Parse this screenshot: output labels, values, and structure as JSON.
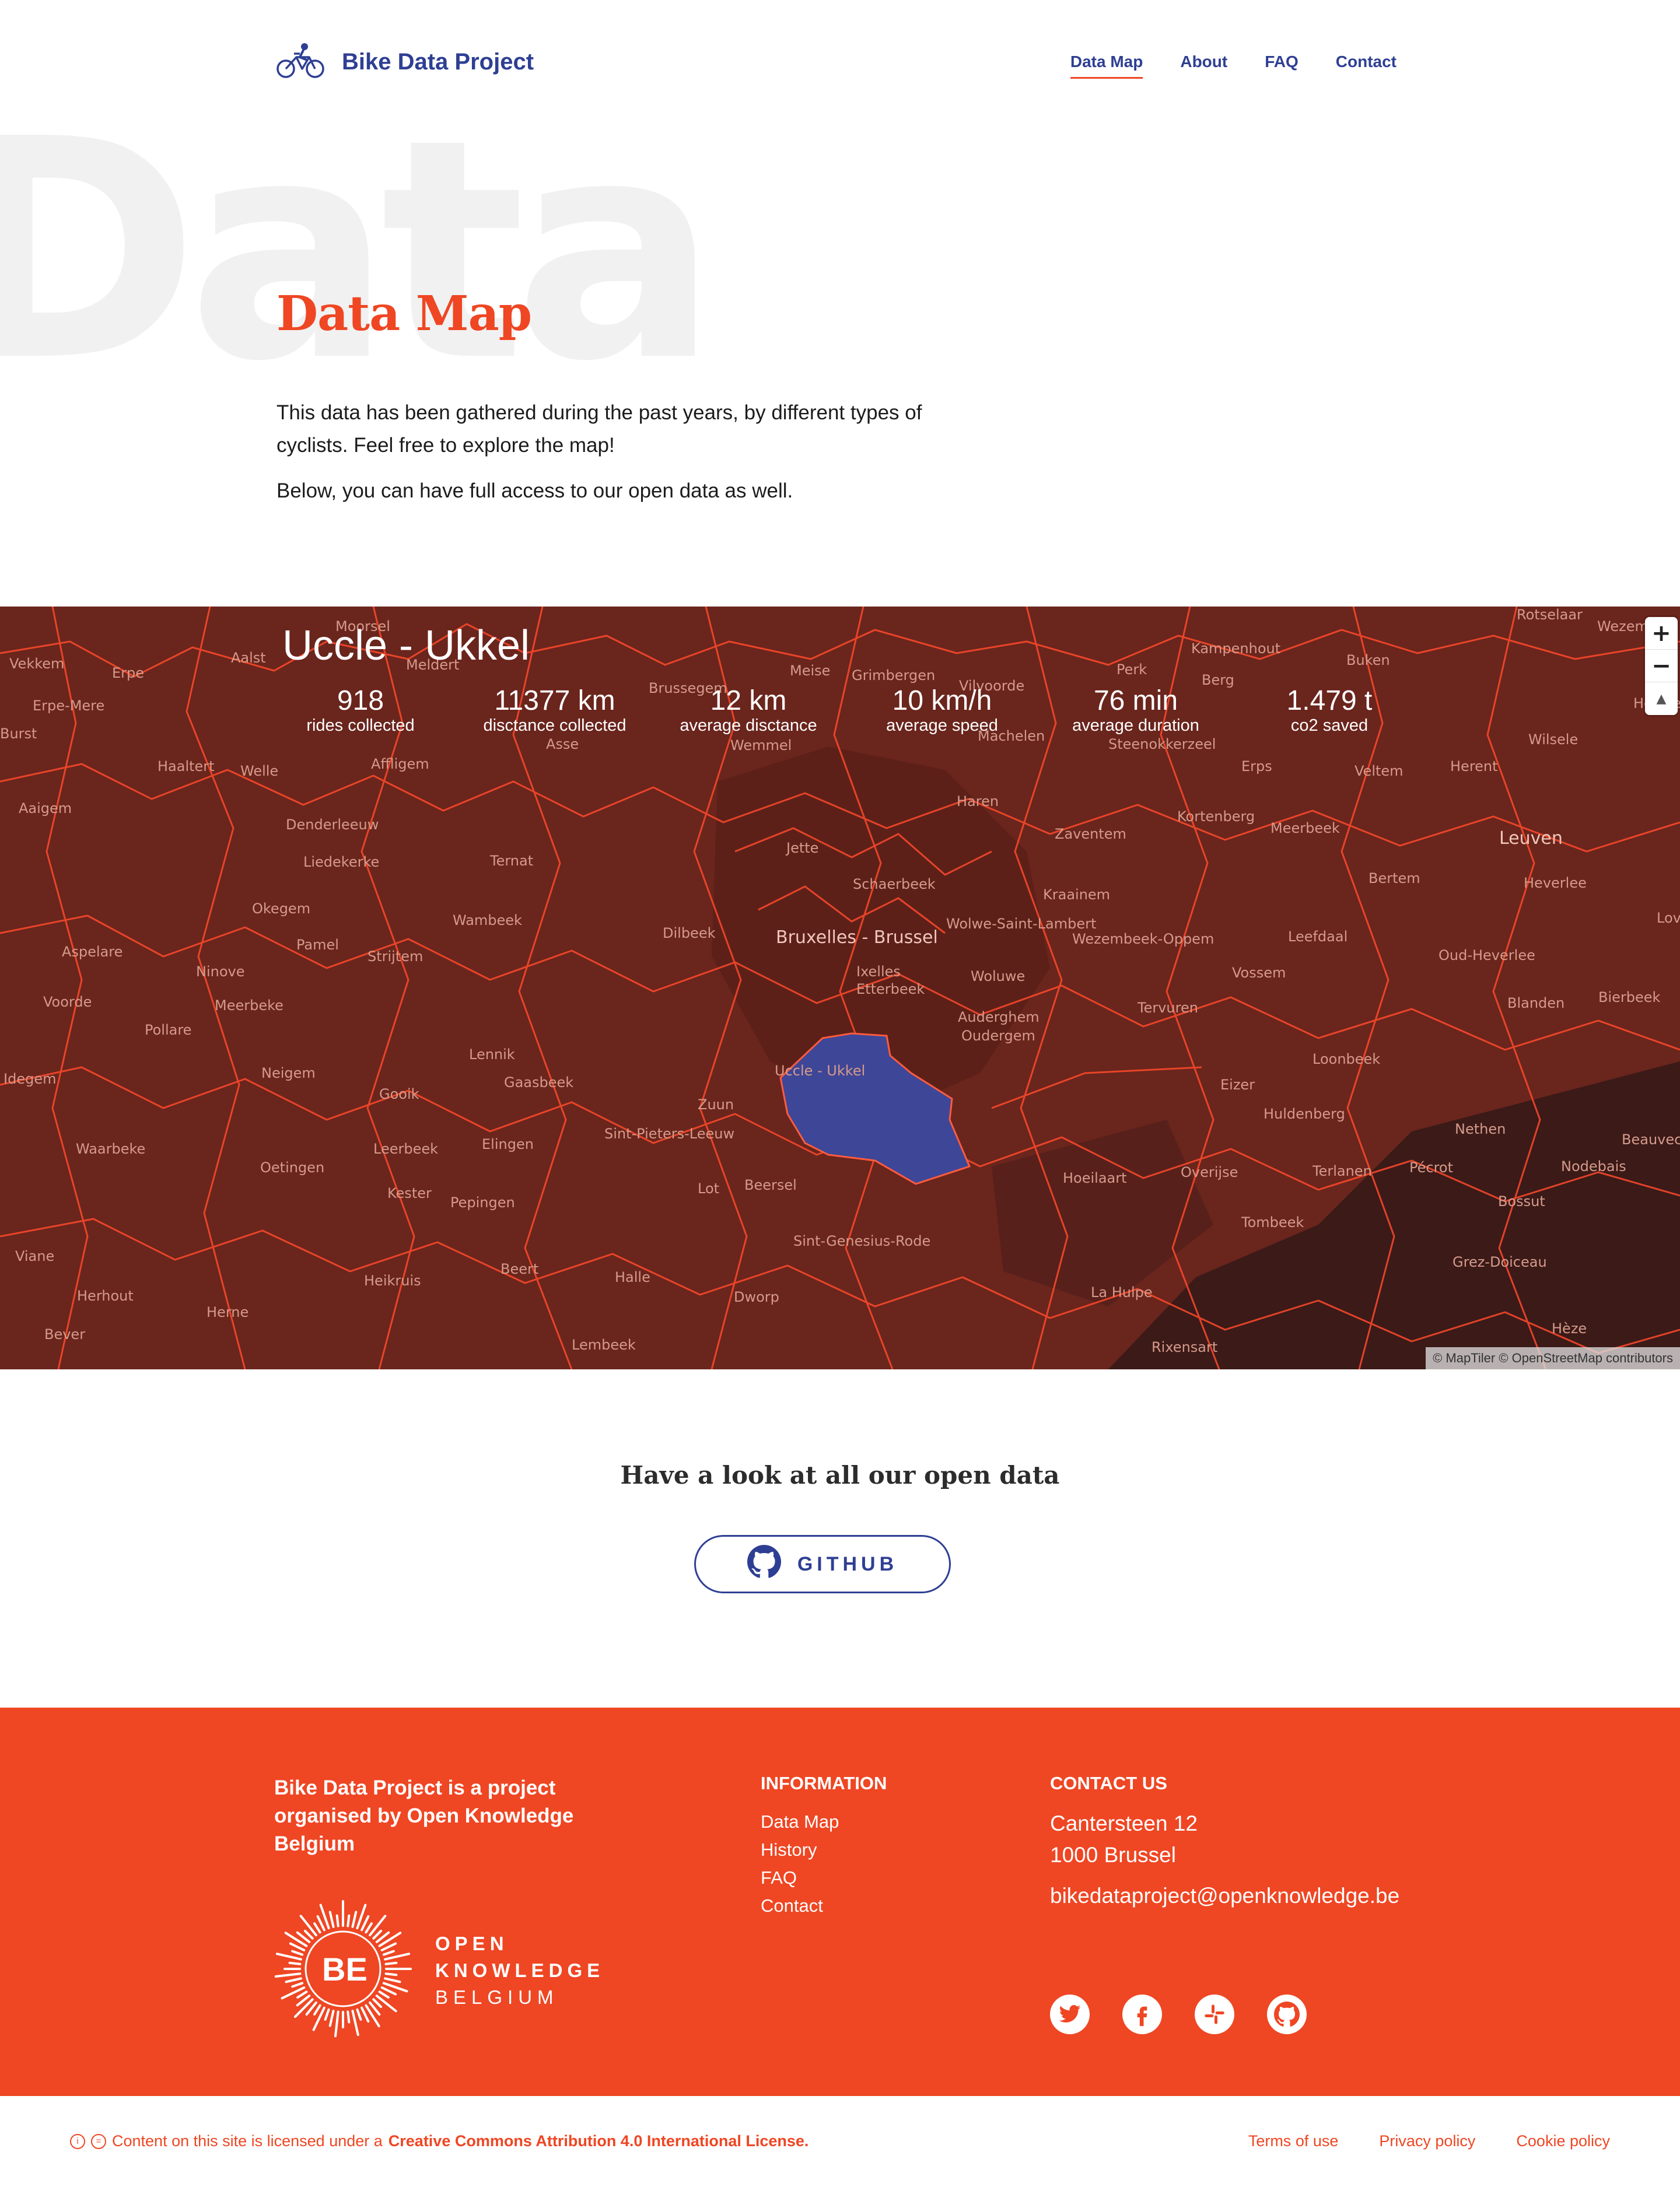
{
  "header": {
    "brand": "Bike Data Project",
    "nav": [
      {
        "label": "Data Map",
        "active": true
      },
      {
        "label": "About"
      },
      {
        "label": "FAQ"
      },
      {
        "label": "Contact"
      }
    ]
  },
  "hero": {
    "ghost_word": "Data",
    "title": "Data Map",
    "paragraphs": [
      "This data has been gathered during the past years, by different types of cyclists. Feel free to explore the map!",
      "Below, you can have full access to our open data as well."
    ]
  },
  "map": {
    "region_name": "Uccle - Ukkel",
    "stats": [
      {
        "value": "918",
        "label": "rides collected"
      },
      {
        "value": "11377 km",
        "label": "disctance collected"
      },
      {
        "value": "12 km",
        "label": "average disctance"
      },
      {
        "value": "10 km/h",
        "label": "average speed"
      },
      {
        "value": "76 min",
        "label": "average duration"
      },
      {
        "value": "1.479 t",
        "label": "co2 saved"
      }
    ],
    "controls": {
      "zoom_in": "+",
      "zoom_out": "−",
      "reset": "▲"
    },
    "attribution": "© MapTiler © OpenStreetMap contributors",
    "places": [
      "Moorsel",
      "Aalst",
      "Erpe",
      "Erpe-Mere",
      "Burst",
      "Haaltert",
      "Welle",
      "Aaigem",
      "Meldert",
      "Affligem",
      "Denderleeuw",
      "Liedekerke",
      "Okegem",
      "Pamel",
      "Aspelare",
      "Ninove",
      "Voorde",
      "Meerbeke",
      "Pollare",
      "Idegem",
      "Neigem",
      "Waarbeke",
      "Oetingen",
      "Herhout",
      "Bever",
      "Viane",
      "Herne",
      "Heikruis",
      "Strijtem",
      "Wambeek",
      "Ternat",
      "Lennik",
      "Gooik",
      "Gaasbeek",
      "Leerbeek",
      "Kester",
      "Pepingen",
      "Elingen",
      "Sint-Pieters-Leeuw",
      "Halle",
      "Beert",
      "Lembeek",
      "Dworp",
      "Zuun",
      "Lot",
      "Beersel",
      "Sint-Genesius-Rode",
      "Brussegem",
      "Asse",
      "Dilbeek",
      "Meise",
      "Grimbergen",
      "Wemmel",
      "Vilvoorde",
      "Machelen",
      "Haren",
      "Jette",
      "Schaerbeek",
      "Bruxelles - Brussel",
      "Ixelles",
      "Etterbeek",
      "Uccle - Ukkel",
      "Wolwe-Saint-Lambert",
      "Woluwe",
      "Auderghem",
      "Oudergem",
      "Zaventem",
      "Kraainem",
      "Wezembeek-Oppem",
      "Tervuren",
      "Kampenhout",
      "Berg",
      "Perk",
      "Buken",
      "Steenokkerzeel",
      "Erps",
      "Kortenberg",
      "Meerbeek",
      "Veltem",
      "Herent",
      "Wilsele",
      "Leuven",
      "Heverlee",
      "Bertem",
      "Leefdaal",
      "Vossem",
      "Oud-Heverlee",
      "Blanden",
      "Eizer",
      "Loonbeek",
      "Huldenberg",
      "Overijse",
      "Hoeilaart",
      "Terlanen",
      "Tombeek",
      "La Hulpe",
      "Rixensart",
      "Nethen",
      "Pécrot",
      "Nodebais",
      "Bossut",
      "Grez-Doiceau",
      "Hèze",
      "Beauvechain",
      "Rotselaar",
      "Wezemaal",
      "Holsbeek",
      "Lovenjoel",
      "Bierbeek",
      "Vekkem"
    ]
  },
  "open_data": {
    "title": "Have a look at all our open data",
    "button": "GITHUB"
  },
  "footer": {
    "about": "Bike Data Project  is a project organised by Open Knowledge Belgium",
    "logo": {
      "badge": "BE",
      "line1": "OPEN",
      "line2": "KNOWLEDGE",
      "line3": "BELGIUM"
    },
    "information_title": "INFORMATION",
    "information_links": [
      "Data Map",
      "History",
      "FAQ",
      "Contact"
    ],
    "contact_title": "CONTACT US",
    "address_line1": "Cantersteen 12",
    "address_line2": "1000 Brussel",
    "email": "bikedataproject@openknowledge.be",
    "socials": [
      "twitter-icon",
      "facebook-icon",
      "slack-icon",
      "github-icon"
    ]
  },
  "bottom_bar": {
    "license_prefix": "Content on this site is licensed under a",
    "license_link": "Creative Commons Attribution 4.0 International License.",
    "links": [
      "Terms of use",
      "Privacy policy",
      "Cookie policy"
    ]
  },
  "colors": {
    "accent": "#ef4623",
    "primary": "#2e3f93",
    "map_fill": "#6a251d",
    "map_border": "#ff4a2b",
    "selected_region": "#3e4697"
  }
}
